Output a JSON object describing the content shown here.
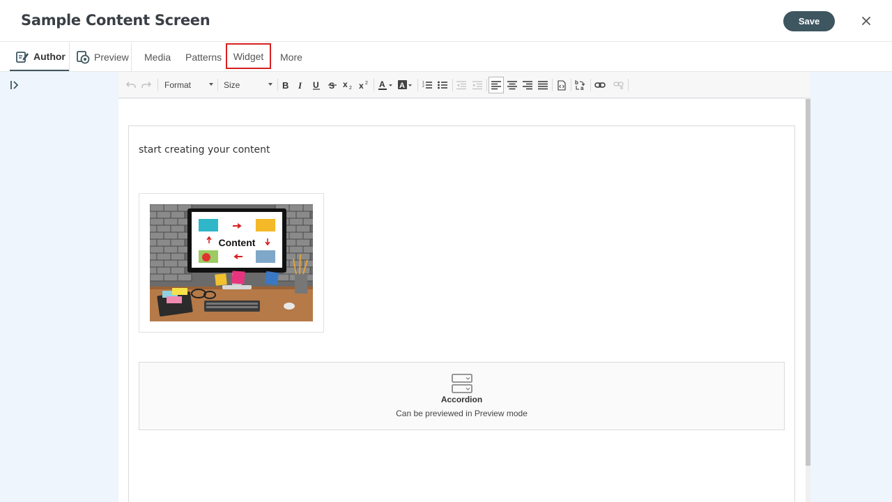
{
  "header": {
    "title": "Sample Content Screen",
    "save_label": "Save",
    "close_glyph": "✕"
  },
  "tabs": {
    "author": "Author",
    "preview": "Preview",
    "media": "Media",
    "patterns": "Patterns",
    "widget": "Widget",
    "more": "More"
  },
  "toolbar": {
    "format_label": "Format",
    "size_label": "Size"
  },
  "editor": {
    "paragraph": "start creating your content",
    "image_caption_word": "Content",
    "widget_title": "Accordion",
    "widget_subtitle": "Can be previewed in Preview mode"
  },
  "colors": {
    "save_bg": "#3d5660",
    "highlight": "#d62020",
    "workspace_bg": "#eef5fc"
  }
}
